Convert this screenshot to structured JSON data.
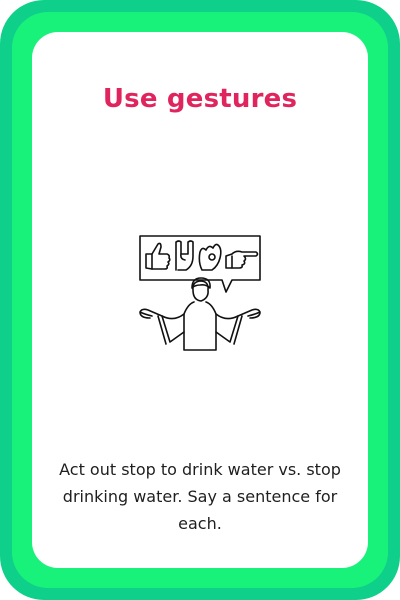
{
  "card": {
    "title": "Use gestures",
    "instruction": "Act out stop to drink water vs. stop drinking water. Say a sentence for each.",
    "illustration_icon": "person-gesturing-with-hand-signs-icon"
  },
  "colors": {
    "outer_border": "#0fd08a",
    "inner_border": "#19f27a",
    "title": "#e0245e",
    "text": "#1f1f1f"
  }
}
